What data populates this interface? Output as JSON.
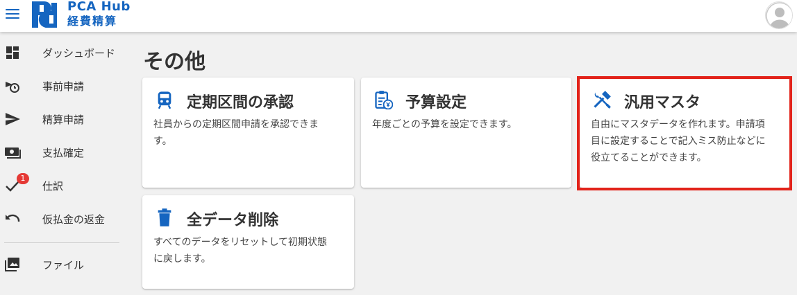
{
  "header": {
    "app_name": "PCA Hub",
    "app_sub": "経費精算",
    "brand_color": "#1565c0"
  },
  "sidebar": {
    "items": [
      {
        "label": "ダッシュボード",
        "icon": "dashboard-icon"
      },
      {
        "label": "事前申請",
        "icon": "pre-application-icon"
      },
      {
        "label": "精算申請",
        "icon": "send-icon"
      },
      {
        "label": "支払確定",
        "icon": "payment-icon"
      },
      {
        "label": "仕訳",
        "icon": "check-icon",
        "badge": "1"
      },
      {
        "label": "仮払金の返金",
        "icon": "undo-icon"
      },
      {
        "label": "ファイル",
        "icon": "image-icon"
      }
    ]
  },
  "main": {
    "title": "その他",
    "cards": [
      {
        "title": "定期区間の承認",
        "desc_lines": [
          "社員からの定期区間申請を承認できま",
          "す。"
        ],
        "icon": "train-icon"
      },
      {
        "title": "予算設定",
        "desc_lines": [
          "年度ごとの予算を設定できます。"
        ],
        "icon": "budget-clipboard-icon"
      },
      {
        "title": "汎用マスタ",
        "desc_lines": [
          "自由にマスタデータを作れます。申請項",
          "目に設定することで記入ミス防止などに",
          "役立てることができます。"
        ],
        "icon": "tools-icon"
      },
      {
        "title": "全データ削除",
        "desc_lines": [
          "すべてのデータをリセットして初期状態",
          "に戻します。"
        ],
        "icon": "trash-icon"
      }
    ],
    "highlight_color": "#e2231a"
  }
}
